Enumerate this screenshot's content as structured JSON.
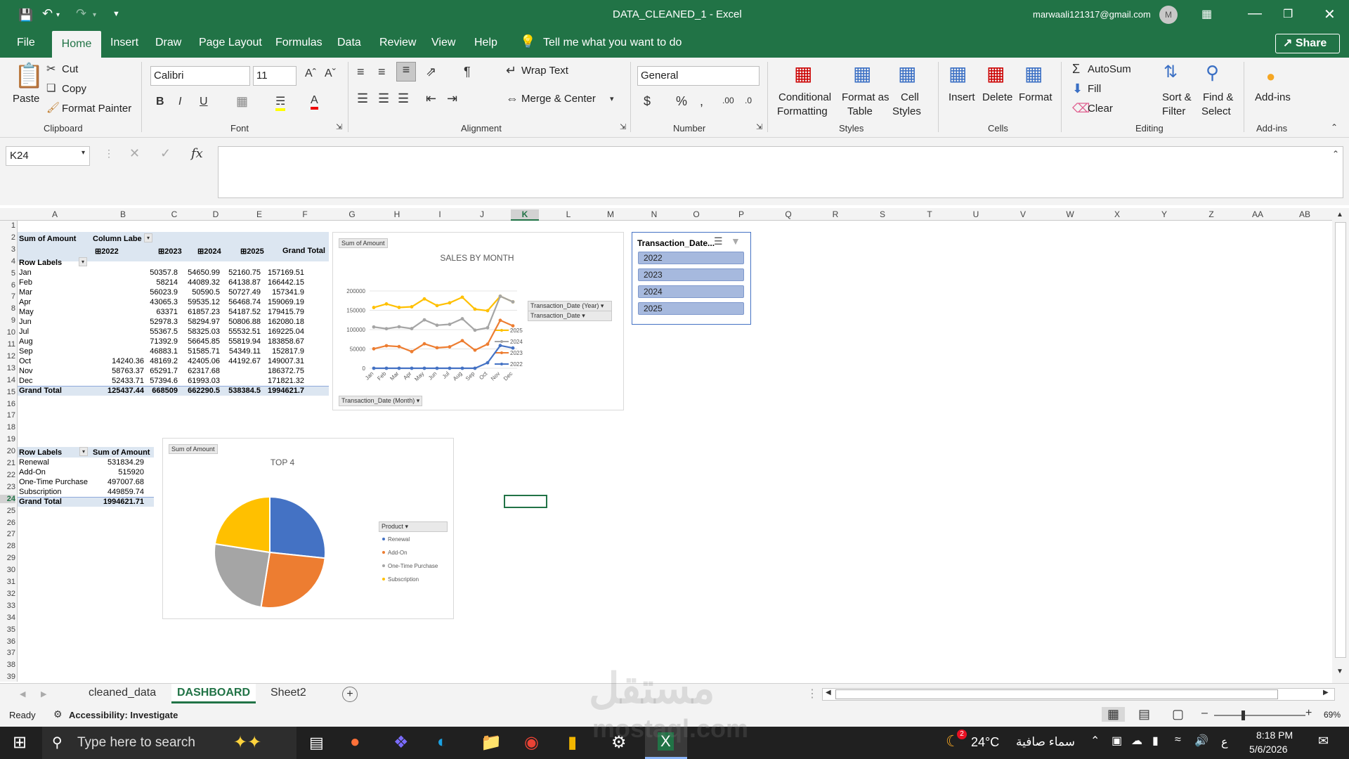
{
  "titlebar": {
    "doc_title": "DATA_CLEANED_1  -  Excel",
    "account": "marwaali121317@gmail.com",
    "avatar": "M"
  },
  "menu": {
    "items": [
      "File",
      "Home",
      "Insert",
      "Draw",
      "Page Layout",
      "Formulas",
      "Data",
      "Review",
      "View",
      "Help"
    ],
    "tell_me": "Tell me what you want to do",
    "share": "Share"
  },
  "ribbon": {
    "clipboard": {
      "paste": "Paste",
      "cut": "Cut",
      "copy": "Copy",
      "format_painter": "Format Painter",
      "label": "Clipboard"
    },
    "font": {
      "name": "Calibri",
      "size": "11",
      "label": "Font"
    },
    "alignment": {
      "wrap": "Wrap Text",
      "merge": "Merge & Center",
      "label": "Alignment"
    },
    "number": {
      "format": "General",
      "label": "Number"
    },
    "styles": {
      "conditional": "Conditional",
      "conditional2": "Formatting",
      "format_table": "Format as",
      "format_table2": "Table",
      "cell_styles": "Cell",
      "cell_styles2": "Styles",
      "label": "Styles"
    },
    "cells": {
      "insert": "Insert",
      "delete": "Delete",
      "format": "Format",
      "label": "Cells"
    },
    "editing": {
      "autosum": "AutoSum",
      "fill": "Fill",
      "clear": "Clear",
      "sort": "Sort &",
      "sort2": "Filter",
      "find": "Find &",
      "find2": "Select",
      "label": "Editing"
    },
    "addins": {
      "btn": "Add-ins",
      "label": "Add-ins"
    }
  },
  "formula": {
    "namebox": "K24",
    "fx": "fx"
  },
  "columns": [
    "A",
    "B",
    "C",
    "D",
    "E",
    "F",
    "G",
    "H",
    "I",
    "J",
    "K",
    "L",
    "M",
    "N",
    "O",
    "P",
    "Q",
    "R",
    "S",
    "T",
    "U",
    "V",
    "W",
    "X",
    "Y",
    "Z",
    "AA",
    "AB"
  ],
  "rows": [
    "1",
    "2",
    "3",
    "4",
    "5",
    "6",
    "7",
    "8",
    "9",
    "10",
    "11",
    "12",
    "13",
    "14",
    "15",
    "16",
    "17",
    "18",
    "19",
    "20",
    "21",
    "22",
    "23",
    "24",
    "25",
    "26",
    "27",
    "28",
    "29",
    "30",
    "31",
    "32",
    "33",
    "34",
    "35",
    "36",
    "37",
    "38",
    "39"
  ],
  "pivot1": {
    "sum_label": "Sum of Amount",
    "col_label": "Column Labe",
    "row_labels": "Row Labels",
    "years": [
      "2022",
      "2023",
      "2024",
      "2025"
    ],
    "grand_total": "Grand Total",
    "rows": [
      {
        "m": "Jan",
        "v": [
          "",
          "50357.8",
          "54650.99",
          "52160.75",
          "157169.51"
        ]
      },
      {
        "m": "Feb",
        "v": [
          "",
          "58214",
          "44089.32",
          "64138.87",
          "166442.15"
        ]
      },
      {
        "m": "Mar",
        "v": [
          "",
          "56023.9",
          "50590.5",
          "50727.49",
          "157341.9"
        ]
      },
      {
        "m": "Apr",
        "v": [
          "",
          "43065.3",
          "59535.12",
          "56468.74",
          "159069.19"
        ]
      },
      {
        "m": "May",
        "v": [
          "",
          "63371",
          "61857.23",
          "54187.52",
          "179415.79"
        ]
      },
      {
        "m": "Jun",
        "v": [
          "",
          "52978.3",
          "58294.97",
          "50806.88",
          "162080.18"
        ]
      },
      {
        "m": "Jul",
        "v": [
          "",
          "55367.5",
          "58325.03",
          "55532.51",
          "169225.04"
        ]
      },
      {
        "m": "Aug",
        "v": [
          "",
          "71392.9",
          "56645.85",
          "55819.94",
          "183858.67"
        ]
      },
      {
        "m": "Sep",
        "v": [
          "",
          "46883.1",
          "51585.71",
          "54349.11",
          "152817.9"
        ]
      },
      {
        "m": "Oct",
        "v": [
          "14240.36",
          "48169.2",
          "42405.06",
          "44192.67",
          "149007.31"
        ]
      },
      {
        "m": "Nov",
        "v": [
          "58763.37",
          "65291.7",
          "62317.68",
          "",
          "186372.75"
        ]
      },
      {
        "m": "Dec",
        "v": [
          "52433.71",
          "57394.6",
          "61993.03",
          "",
          "171821.32"
        ]
      }
    ],
    "total": [
      "125437.44",
      "668509",
      "662290.5",
      "538384.5",
      "1994621.7"
    ]
  },
  "pivot2": {
    "row_labels": "Row Labels",
    "sum_label": "Sum of Amount",
    "rows": [
      {
        "p": "Renewal",
        "v": "531834.29"
      },
      {
        "p": "Add-On",
        "v": "515920"
      },
      {
        "p": "One-Time Purchase",
        "v": "497007.68"
      },
      {
        "p": "Subscription",
        "v": "449859.74"
      }
    ],
    "grand_total": "Grand Total",
    "total": "1994621.71"
  },
  "chart_data": [
    {
      "type": "line",
      "title": "SALES BY MONTH",
      "field_button": "Sum of Amount",
      "axis_button": "Transaction_Date (Month)",
      "legend_buttons": [
        "Transaction_Date (Year)",
        "Transaction_Date"
      ],
      "categories": [
        "Jan",
        "Feb",
        "Mar",
        "Apr",
        "May",
        "Jun",
        "Jul",
        "Aug",
        "Sep",
        "Oct",
        "Nov",
        "Dec"
      ],
      "ylim": [
        0,
        200000
      ],
      "yticks": [
        "0",
        "50000",
        "100000",
        "150000",
        "200000"
      ],
      "series": [
        {
          "name": "2025",
          "color": "#ffc000",
          "values": [
            157169.51,
            166442.15,
            157341.9,
            159069.19,
            179415.79,
            162080.18,
            169225.04,
            183858.67,
            152817.9,
            149007.31,
            186372.75,
            171821.32
          ]
        },
        {
          "name": "2024",
          "color": "#a5a5a5",
          "values": [
            106811.74,
            102303.47,
            107318.4,
            102600.45,
            125228.23,
            111273.27,
            113692.53,
            128038.75,
            98468.81,
            104814.62,
            186372.75,
            171821.32
          ]
        },
        {
          "name": "2023",
          "color": "#ed7d31",
          "values": [
            50357.8,
            58214,
            56023.9,
            43065.3,
            63371,
            52978.3,
            55367.5,
            71392.9,
            46883.1,
            62409.56,
            124055.07,
            109828.31
          ]
        },
        {
          "name": "2022",
          "color": "#4472c4",
          "values": [
            0,
            0,
            0,
            0,
            0,
            0,
            0,
            0,
            0,
            14240.36,
            58763.37,
            52433.71
          ]
        }
      ]
    },
    {
      "type": "pie",
      "title": "TOP 4",
      "field_button": "Sum of Amount",
      "legend_button": "Product",
      "categories": [
        "Renewal",
        "Add-On",
        "One-Time Purchase",
        "Subscription"
      ],
      "values": [
        531834.29,
        515920,
        497007.68,
        449859.74
      ],
      "colors": [
        "#4472c4",
        "#ed7d31",
        "#a5a5a5",
        "#ffc000"
      ]
    }
  ],
  "slicer": {
    "title": "Transaction_Date...",
    "items": [
      "2022",
      "2023",
      "2024",
      "2025"
    ]
  },
  "sheet_tabs": [
    "cleaned_data",
    "DASHBOARD",
    "Sheet2"
  ],
  "status": {
    "ready": "Ready",
    "accessibility": "Accessibility: Investigate",
    "zoom": "69%"
  },
  "taskbar": {
    "search": "Type here to search",
    "weather": "24°C",
    "weather_text": "سماء صافية",
    "time": "8:18 PM",
    "date": "5/6/2026",
    "lang": "ع",
    "badge": "2"
  },
  "watermark": {
    "ar": "مستقل",
    "en": "mostaql.com"
  }
}
